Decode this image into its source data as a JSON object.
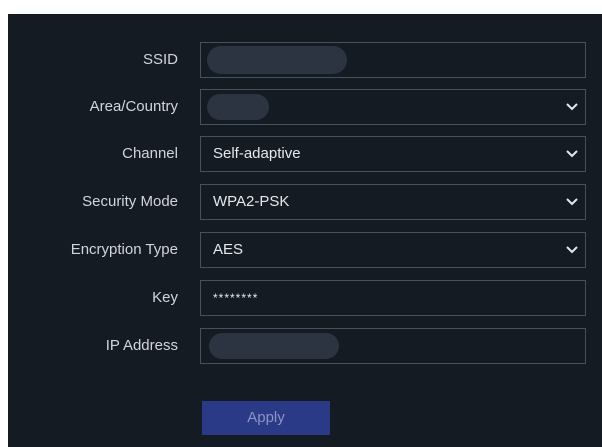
{
  "form": {
    "ssid": {
      "label": "SSID",
      "value": ""
    },
    "area_country": {
      "label": "Area/Country",
      "value": ""
    },
    "channel": {
      "label": "Channel",
      "value": "Self-adaptive"
    },
    "security_mode": {
      "label": "Security Mode",
      "value": "WPA2-PSK"
    },
    "encryption_type": {
      "label": "Encryption Type",
      "value": "AES"
    },
    "key": {
      "label": "Key",
      "value": "********"
    },
    "ip_address": {
      "label": "IP Address",
      "value": ""
    }
  },
  "apply_label": "Apply",
  "colors": {
    "background": "#151b23",
    "field_border": "#4a505a",
    "label_text": "#d2d5da",
    "apply_button": "#2a3a86"
  },
  "icons": {
    "dropdown": "chevron-down-icon"
  }
}
